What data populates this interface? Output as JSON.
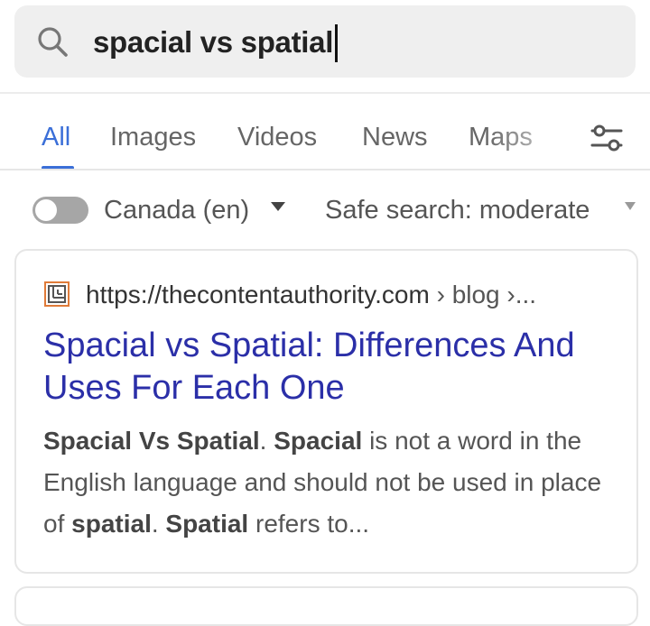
{
  "search": {
    "query": "spacial vs spatial"
  },
  "tabs": [
    {
      "label": "All",
      "active": true
    },
    {
      "label": "Images"
    },
    {
      "label": "Videos"
    },
    {
      "label": "News"
    },
    {
      "label": "Maps"
    }
  ],
  "filters": {
    "region_toggle_on": false,
    "region": "Canada (en)",
    "safe_search": "Safe search: moderate"
  },
  "result": {
    "url_main": "https://thecontentauthority.com",
    "url_path": " › blog ›...",
    "title": "Spacial vs Spatial: Differences And Uses For Each One",
    "snippet_parts": [
      {
        "text": "Spacial Vs Spatial",
        "bold": true
      },
      {
        "text": ". ",
        "bold": false
      },
      {
        "text": "Spacial",
        "bold": true
      },
      {
        "text": " is not a word in the English language and should not be used in place of ",
        "bold": false
      },
      {
        "text": "spatial",
        "bold": true
      },
      {
        "text": ". ",
        "bold": false
      },
      {
        "text": "Spatial",
        "bold": true
      },
      {
        "text": " refers to...",
        "bold": false
      }
    ]
  },
  "colors": {
    "accent": "#3b6fd8",
    "result_title": "#2b2fa8"
  },
  "icons": [
    "search-icon",
    "settings-sliders-icon",
    "caret-down-icon",
    "site-favicon"
  ]
}
